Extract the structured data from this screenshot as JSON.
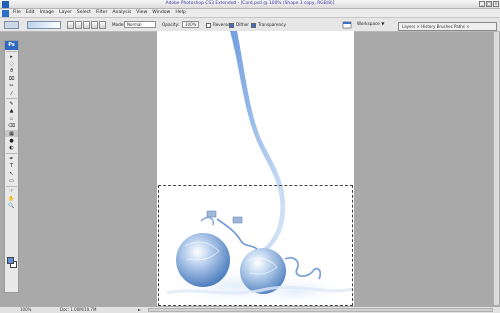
{
  "title_bar": {
    "title": "Adobe Photoshop CS3 Extended - [Card.psd @ 100% (Shape 3 copy, RGB/8)]",
    "minimize": "_",
    "maximize": "□",
    "close": "×"
  },
  "menu": {
    "items": [
      "File",
      "Edit",
      "Image",
      "Layer",
      "Select",
      "Filter",
      "Analysis",
      "View",
      "Window",
      "Help"
    ]
  },
  "options": {
    "mode_label": "Mode:",
    "mode_value": "Normal",
    "opacity_label": "Opacity:",
    "opacity_value": "100%",
    "reverse_label": "Reverse",
    "dither_label": "Dither",
    "transparency_label": "Transparency",
    "workspace_label": "Workspace ▼",
    "palette_well": "Layers × History Brushes Paths ×"
  },
  "toolbox": {
    "logo": "Ps",
    "tools": [
      "▸",
      "◌",
      "ϑ",
      "⌧",
      "✂",
      "⁄",
      "✎",
      "▲",
      "♨",
      "⌫",
      "▦",
      "●",
      "◐",
      "✒",
      "T",
      "↖",
      "▭",
      "☞",
      "✋",
      "🔍"
    ]
  },
  "status": {
    "zoom": "100%",
    "doc_info": "Doc: 1.00M/10.7M",
    "arrow": "►"
  },
  "colors": {
    "foreground": "#5b8fd8",
    "background": "#ffffff",
    "accent": "#2f6ac0"
  }
}
